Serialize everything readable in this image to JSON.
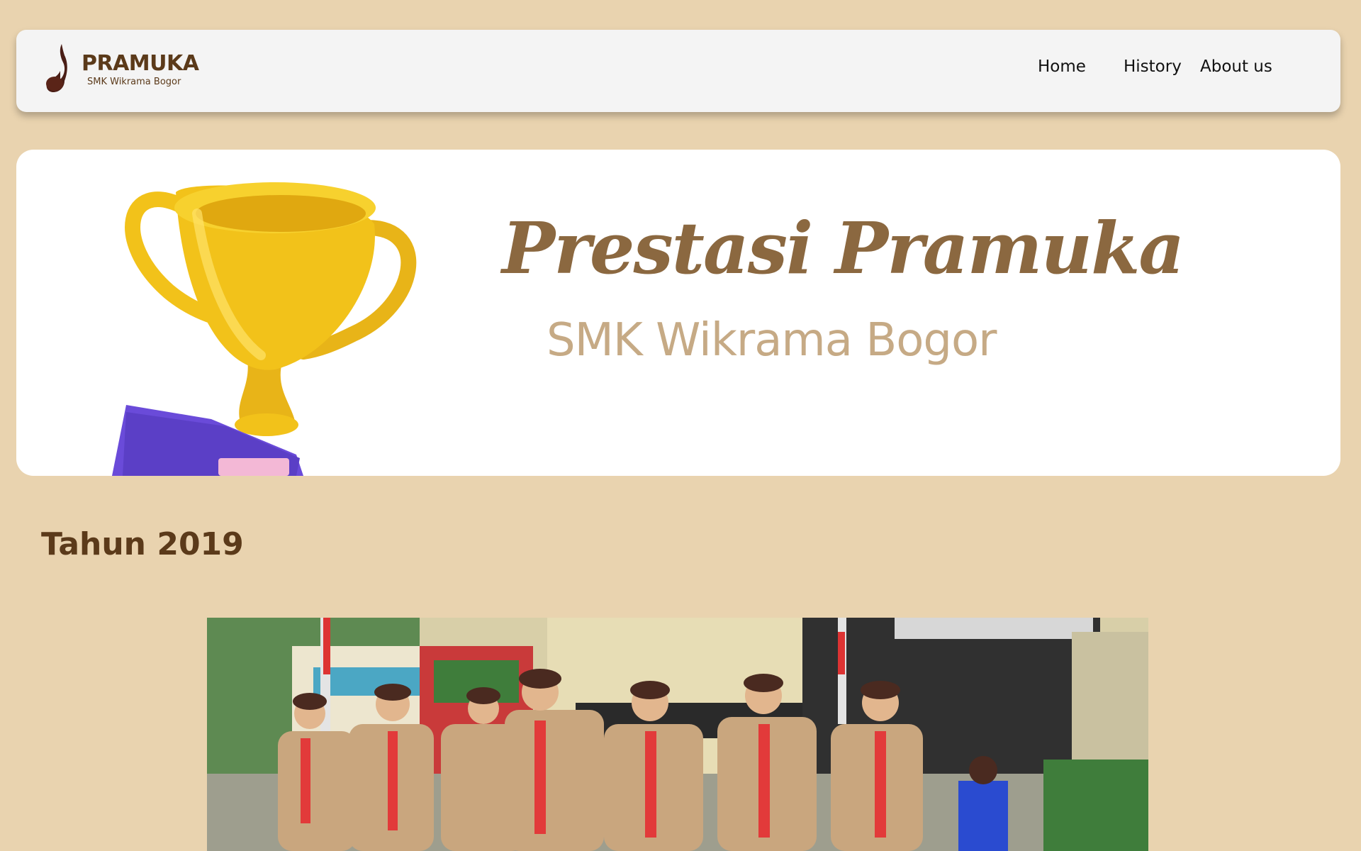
{
  "navbar": {
    "brand_title": "PRAMUKA",
    "brand_subtitle": "SMK Wikrama Bogor",
    "logo_icon": "pramuka-tunas-kelapa-icon",
    "links": [
      {
        "label": "Home"
      },
      {
        "label": "History"
      },
      {
        "label": "About us"
      }
    ]
  },
  "hero": {
    "title": "Prestasi Pramuka",
    "subtitle": "SMK Wikrama Bogor",
    "image_icon": "trophy-icon"
  },
  "main": {
    "section_title": "Tahun 2019",
    "photo_icon": "scouts-marching-photo"
  },
  "colors": {
    "background": "#E9D3AF",
    "navbar": "#F4F4F4",
    "brand_brown": "#5B3A1A",
    "title_brown": "#8B6840",
    "subtitle_tan": "#C6AA85",
    "trophy_gold": "#F2C21A",
    "trophy_base": "#6A4BD9"
  }
}
